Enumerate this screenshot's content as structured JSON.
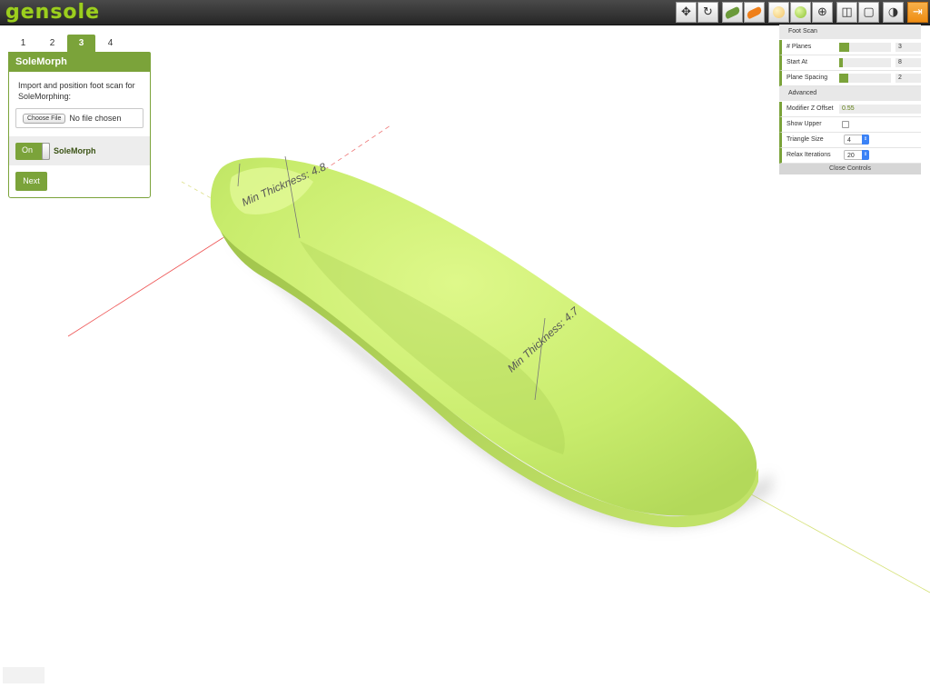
{
  "app": {
    "logo": "gensole"
  },
  "toolbar": {
    "tools": [
      {
        "name": "move-icon",
        "glyph": "✥"
      },
      {
        "name": "reset-view-icon",
        "glyph": "↻"
      },
      {
        "name": "green-shoe-icon",
        "color": "#6b9a3a"
      },
      {
        "name": "orange-shoe-icon",
        "color": "#ef7f1a"
      },
      {
        "name": "yellow-material-icon",
        "color": "#f3d27a"
      },
      {
        "name": "green-material-icon",
        "color": "#9bcf3a"
      },
      {
        "name": "wireframe-globe-icon",
        "glyph": "⊕"
      },
      {
        "name": "box-solid-icon",
        "glyph": "◫"
      },
      {
        "name": "box-wire-icon",
        "glyph": "▢"
      },
      {
        "name": "shading-icon",
        "glyph": "◑"
      },
      {
        "name": "exit-icon",
        "glyph": "⇥"
      }
    ]
  },
  "steps": [
    "1",
    "2",
    "3",
    "4"
  ],
  "current_step": "3",
  "panel": {
    "title": "SoleMorph",
    "description": "Import and position foot scan for SoleMorphing:",
    "file_button": "Choose File",
    "file_status": "No file chosen",
    "toggle_state": "On",
    "toggle_label": "SoleMorph",
    "next_button": "Next"
  },
  "controls": {
    "section_foot_scan": "Foot Scan",
    "planes_label": "# Planes",
    "planes_value": "3",
    "planes_fill": 0.2,
    "start_label": "Start At",
    "start_value": "8",
    "start_fill": 0.07,
    "spacing_label": "Plane Spacing",
    "spacing_value": "2",
    "spacing_fill": 0.18,
    "section_advanced": "Advanced",
    "offset_label": "Modifier Z Offset",
    "offset_value": "0.55",
    "upper_label": "Show Upper",
    "tri_label": "Triangle Size",
    "tri_value": "4",
    "relax_label": "Relax Iterations",
    "relax_value": "20",
    "close_label": "Close Controls"
  },
  "annotations": {
    "heel": "Min Thickness: 4.8",
    "arch": "Min Thickness: 4.7"
  },
  "colors": {
    "accent": "#7ba33a",
    "insole": "#c7ea6a",
    "orange": "#ef8d12"
  }
}
